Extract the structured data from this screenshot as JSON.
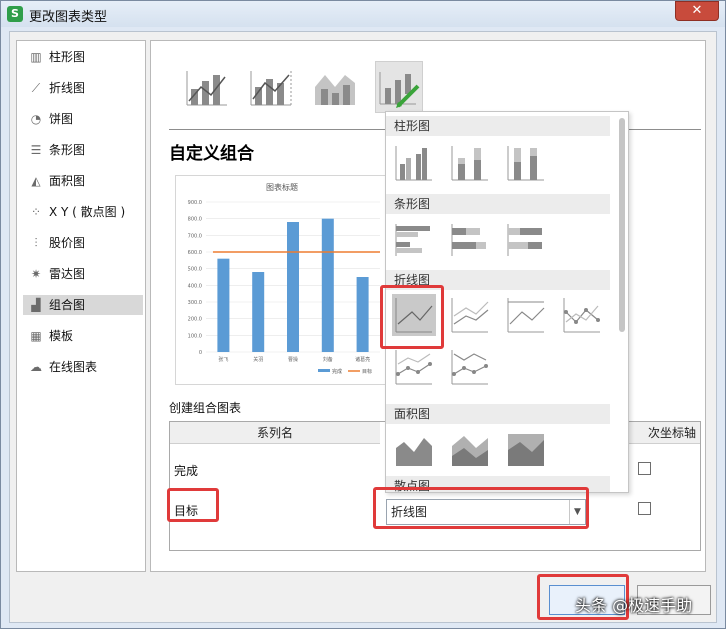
{
  "window": {
    "title": "更改图表类型",
    "app_icon": "S",
    "close_glyph": "✕"
  },
  "sidebar": {
    "items": [
      {
        "label": "柱形图",
        "icon": "column-chart-icon",
        "active": false
      },
      {
        "label": "折线图",
        "icon": "line-chart-icon",
        "active": false
      },
      {
        "label": "饼图",
        "icon": "pie-chart-icon",
        "active": false
      },
      {
        "label": "条形图",
        "icon": "bar-chart-icon",
        "active": false
      },
      {
        "label": "面积图",
        "icon": "area-chart-icon",
        "active": false
      },
      {
        "label": "X Y ( 散点图 )",
        "icon": "scatter-chart-icon",
        "active": false
      },
      {
        "label": "股价图",
        "icon": "stock-chart-icon",
        "active": false
      },
      {
        "label": "雷达图",
        "icon": "radar-chart-icon",
        "active": false
      },
      {
        "label": "组合图",
        "icon": "combo-chart-icon",
        "active": true
      },
      {
        "label": "模板",
        "icon": "template-icon",
        "active": false
      },
      {
        "label": "在线图表",
        "icon": "online-chart-icon",
        "active": false
      }
    ]
  },
  "main": {
    "section_title": "自定义组合",
    "create_label": "创建组合图表",
    "columns": {
      "series": "系列名",
      "axis": "次坐标轴"
    },
    "rows": [
      {
        "name": "完成"
      },
      {
        "name": "目标",
        "chart_type": "折线图"
      }
    ]
  },
  "preview_chart": {
    "chart_data": {
      "type": "bar",
      "title": "图表标题",
      "categories": [
        "张飞",
        "关羽",
        "曹操",
        "刘备",
        "诸葛亮"
      ],
      "series": [
        {
          "name": "完成",
          "type": "bar",
          "values": [
            560,
            480,
            780,
            800,
            450
          ]
        },
        {
          "name": "目标",
          "type": "line",
          "values": [
            600,
            600,
            600,
            600,
            600
          ]
        }
      ],
      "yticks": [
        "0",
        "100.0",
        "200.0",
        "300.0",
        "400.0",
        "500.0",
        "600.0",
        "700.0",
        "800.0",
        "900.0"
      ],
      "ylim": [
        0,
        900
      ],
      "legend": "bottom",
      "grid": true,
      "colors": {
        "bar": "#5b9bd5",
        "line": "#ed7d31"
      }
    }
  },
  "popup": {
    "groups": [
      "柱形图",
      "条形图",
      "折线图",
      "面积图",
      "散点图"
    ]
  },
  "footer": {
    "ok_label": "",
    "cancel_label": "",
    "watermark": "头条 @极速手助"
  },
  "colors": {
    "highlight": "#e03a3a",
    "accent": "#3aa43a"
  }
}
